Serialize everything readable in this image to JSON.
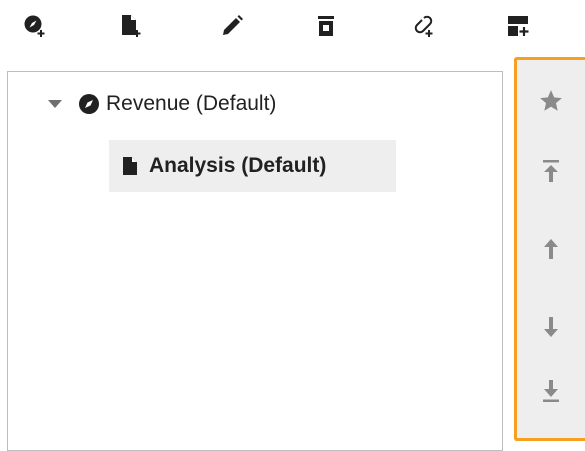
{
  "toolbar": {
    "buttons": [
      {
        "icon": "add-dashboard-icon"
      },
      {
        "icon": "add-page-icon"
      },
      {
        "icon": "edit-icon"
      },
      {
        "icon": "delete-icon"
      },
      {
        "icon": "add-link-icon"
      },
      {
        "icon": "add-layout-icon"
      }
    ]
  },
  "tree": {
    "root": {
      "label": "Revenue (Default)",
      "expanded": true,
      "icon": "dashboard-icon"
    },
    "child": {
      "label": "Analysis (Default)",
      "icon": "page-icon",
      "selected": true
    }
  },
  "side_actions": [
    {
      "icon": "star-icon"
    },
    {
      "icon": "move-to-top-icon"
    },
    {
      "icon": "move-up-icon"
    },
    {
      "icon": "move-down-icon"
    },
    {
      "icon": "move-to-bottom-icon"
    }
  ],
  "colors": {
    "icon_dark": "#212121",
    "icon_grey": "#8a8a8a",
    "highlight_border": "#f5a020",
    "selected_bg": "#eeeeee",
    "panel_border": "#bdbdbd"
  }
}
